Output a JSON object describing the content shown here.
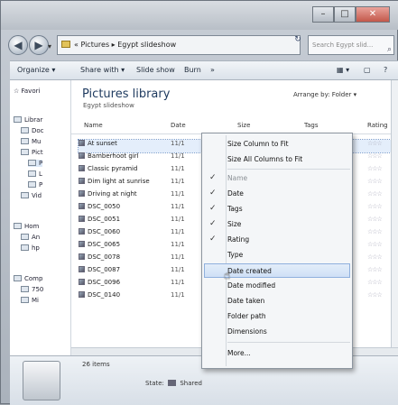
{
  "window": {
    "controls": {
      "minimize": "–",
      "maximize": "□",
      "close": "✕"
    }
  },
  "address": {
    "back": "◀",
    "forward": "▶",
    "dropdown": "▾",
    "path": "« Pictures ▸ Egypt slideshow",
    "path_dropdown": "▾",
    "refresh": "↻",
    "search_placeholder": "Search Egypt slid...",
    "search_icon": "⌕"
  },
  "toolbar": {
    "organize": "Organize ▾",
    "share_with": "Share with ▾",
    "slide_show": "Slide show",
    "burn": "Burn",
    "more": "»",
    "views": "▦ ▾",
    "preview": "▢",
    "help": "?"
  },
  "navpane": {
    "favorites": "☆ Favori",
    "libraries": "Librar",
    "documents": "Doc",
    "music": "Mu",
    "pictures": "Pict",
    "p1": "P",
    "p2": "L",
    "p3": "P",
    "videos": "Vid",
    "homegroup": "Hom",
    "an": "An",
    "hp": "hp",
    "computer": "Comp",
    "drive": "750",
    "drive2": "Mi"
  },
  "content": {
    "title": "Pictures library",
    "subtitle": "Egypt slideshow",
    "arrange_label": "Arrange by:",
    "arrange_value": "Folder ▾",
    "columns": {
      "name": "Name",
      "date": "Date",
      "size": "Size",
      "tags": "Tags",
      "rating": "Rating"
    },
    "rows": [
      {
        "name": "At sunset",
        "date": "11/1",
        "selected": true
      },
      {
        "name": "Bamberhoot girl",
        "date": "11/1"
      },
      {
        "name": "Classic pyramid",
        "date": "11/1"
      },
      {
        "name": "Dim light at sunrise",
        "date": "11/1"
      },
      {
        "name": "Driving at night",
        "date": "11/1"
      },
      {
        "name": "DSC_0050",
        "date": "11/1"
      },
      {
        "name": "DSC_0051",
        "date": "11/1"
      },
      {
        "name": "DSC_0060",
        "date": "11/1"
      },
      {
        "name": "DSC_0065",
        "date": "11/1"
      },
      {
        "name": "DSC_0078",
        "date": "11/1"
      },
      {
        "name": "DSC_0087",
        "date": "11/1"
      },
      {
        "name": "DSC_0096",
        "date": "11/1"
      },
      {
        "name": "DSC_0140",
        "date": "11/1"
      }
    ],
    "stars": "☆☆☆"
  },
  "context_menu": {
    "size_column": "Size Column to Fit",
    "size_all": "Size All Columns to Fit",
    "name": "Name",
    "date": "Date",
    "tags": "Tags",
    "size": "Size",
    "rating": "Rating",
    "type": "Type",
    "date_created": "Date created",
    "date_modified": "Date modified",
    "date_taken": "Date taken",
    "folder_path": "Folder path",
    "dimensions": "Dimensions",
    "more": "More...",
    "check": "✓"
  },
  "details": {
    "count": "26 items",
    "state_label": "State:",
    "state_value": "Shared"
  }
}
